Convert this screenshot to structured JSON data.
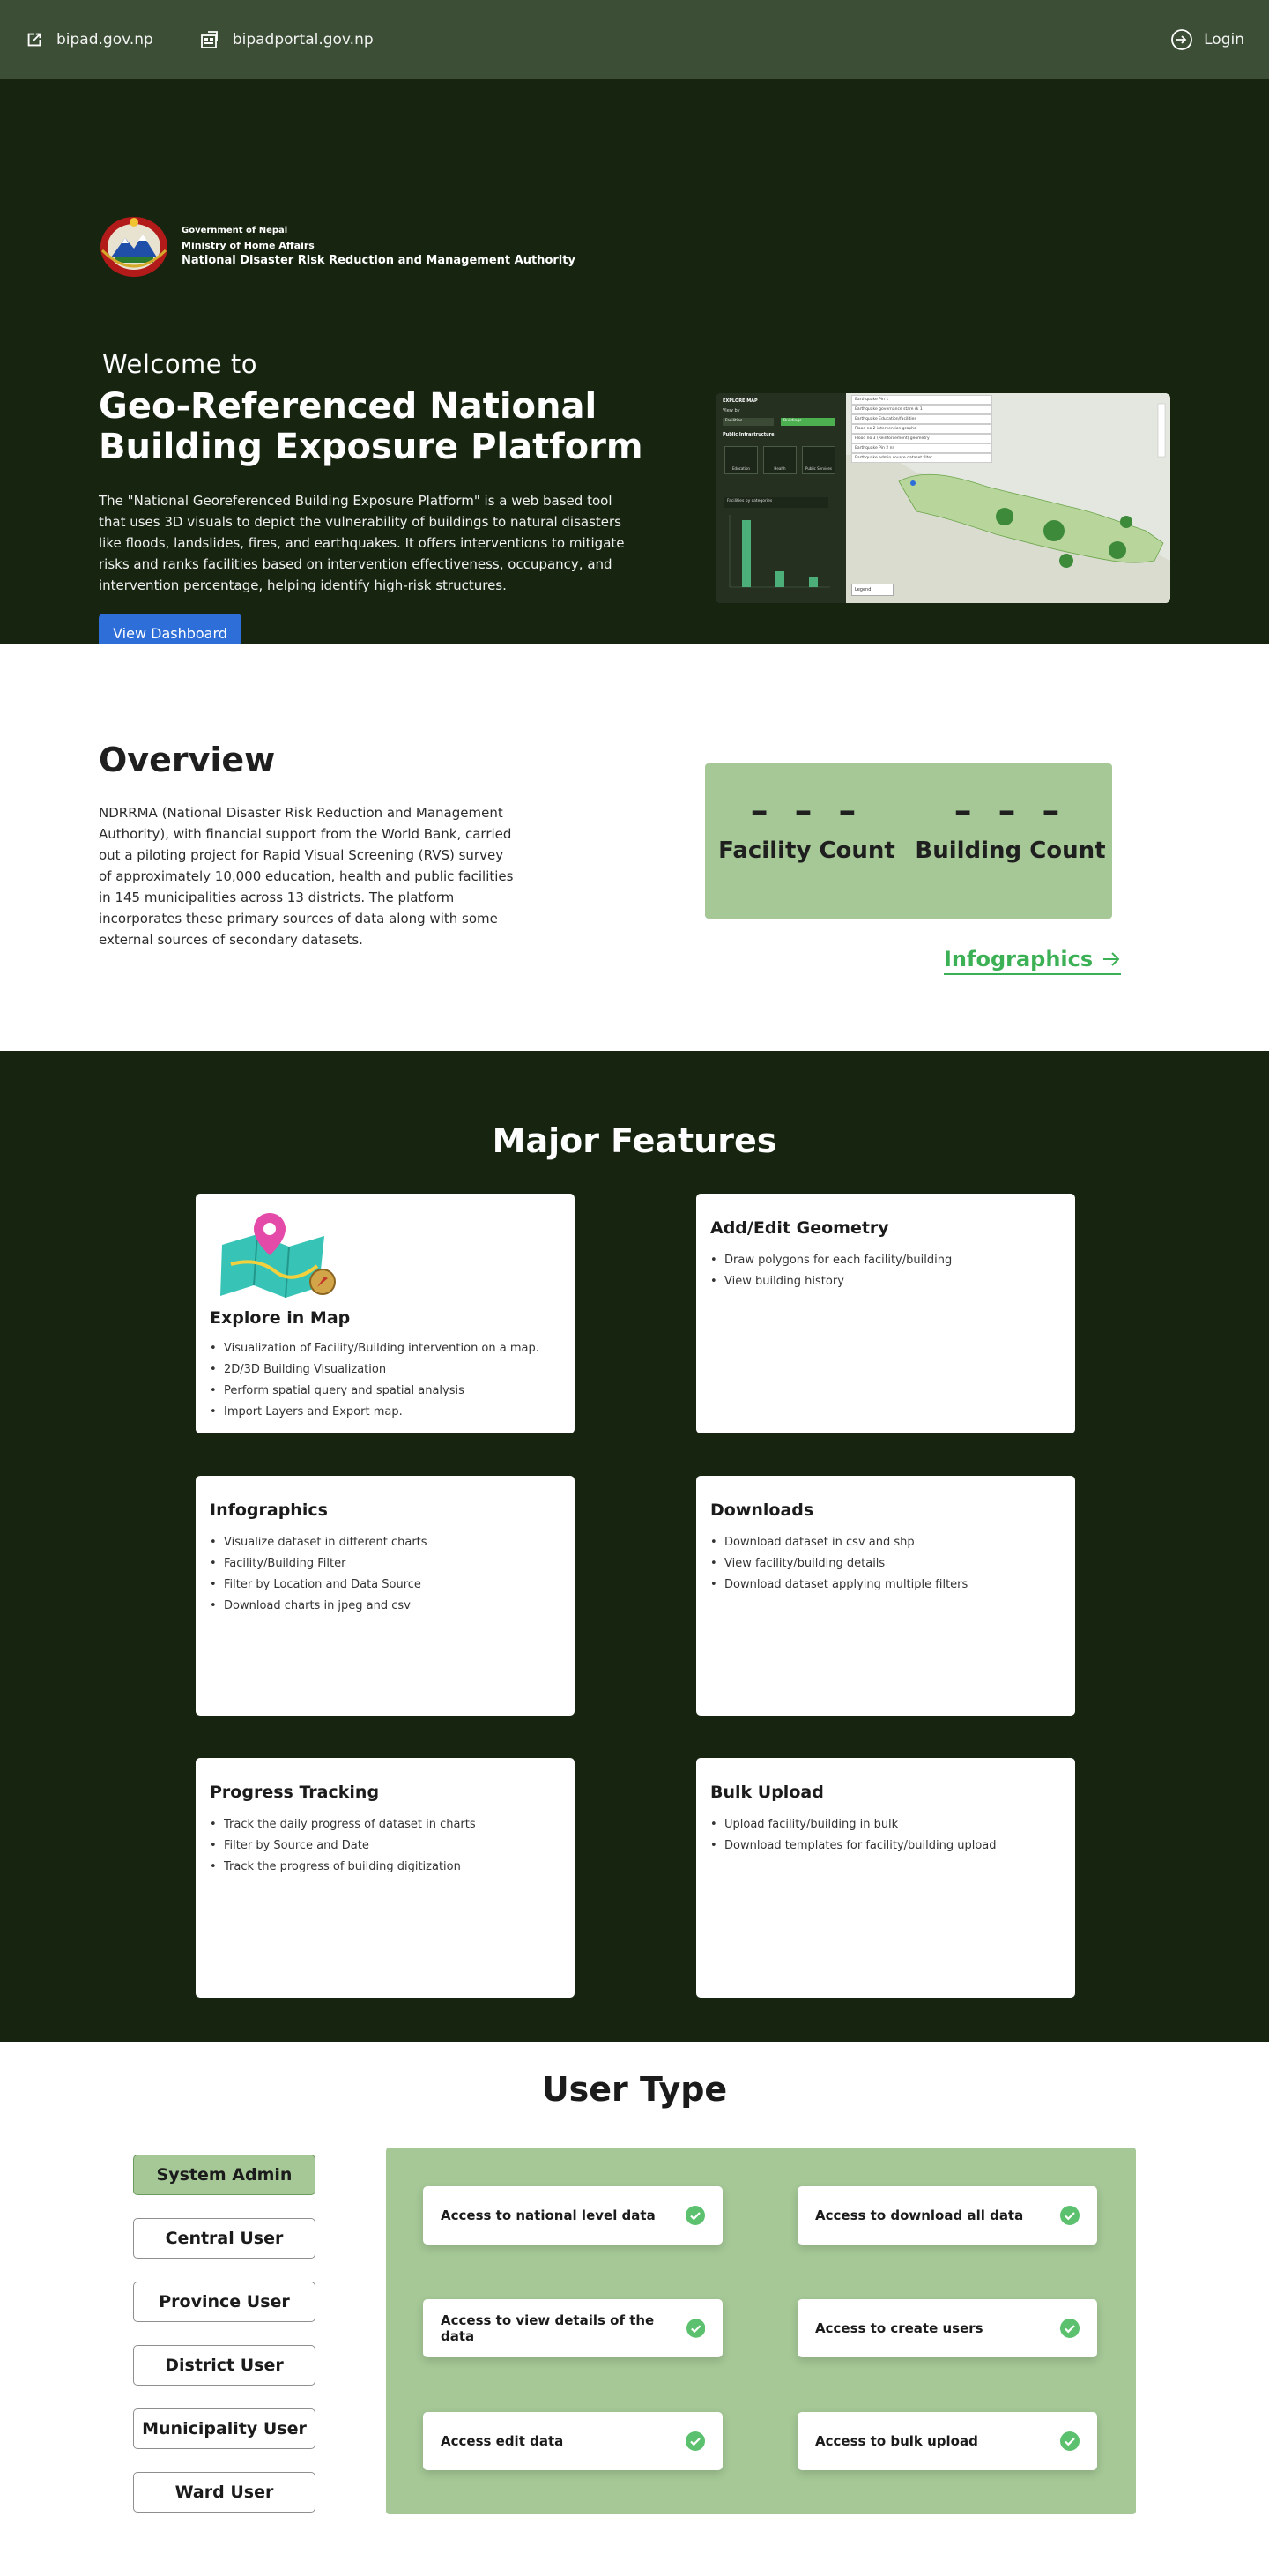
{
  "topbar": {
    "links": [
      {
        "label": "bipad.gov.np",
        "icon": "external-link-icon"
      },
      {
        "label": "bipadportal.gov.np",
        "icon": "portal-icon"
      }
    ],
    "login": {
      "label": "Login",
      "icon": "login-icon"
    },
    "bg": "#3c4f36"
  },
  "hero": {
    "org_lines": [
      "Government of Nepal",
      "Ministry of Home Affairs",
      "National Disaster Risk Reduction and Management Authority"
    ],
    "welcome": "Welcome to",
    "title": "Geo-Referenced National Building Exposure Platform",
    "description": "The \"National Georeferenced Building Exposure Platform\" is a web based tool that uses 3D visuals to depict the vulnerability of buildings to natural disasters like floods, landslides, fires, and earthquakes. It offers interventions to mitigate risks and ranks facilities based on intervention effectiveness, occupancy, and intervention percentage, helping identify high-risk structures.",
    "cta": "View Dashboard",
    "bg": "#162410",
    "cta_color": "#2e6ed8",
    "preview": {
      "header": "EXPLORE MAP",
      "view_by": "View by",
      "facilities_tab": "Facilities",
      "buildings_tab": "Buildings",
      "section": "Public Infrastructure",
      "cat1": "Education",
      "cat2": "Health",
      "cat3": "Public Services",
      "chart_label": "Facilities by categories",
      "legend": "Legend",
      "layers": [
        "Earthquake Pin 1",
        "Earthquake governance stare rk 1",
        "Earthquake Education/facilities",
        "Flood no 2 intervention graphs",
        "Flood no 3 (Reinforcement) geometry",
        "Earthquake Pin 2 nr",
        "Earthquake admin source dataset filter"
      ]
    }
  },
  "overview": {
    "title": "Overview",
    "description": "NDRRMA (National Disaster Risk Reduction and Management Authority), with financial support from the World Bank, carried out a piloting project for Rapid Visual Screening (RVS) survey of approximately 10,000 education, health and public facilities in 145 municipalities across 13 districts. The platform incorporates these primary sources of data along with some external sources of secondary datasets.",
    "stats": [
      {
        "value": "– – –",
        "label": "Facility Count"
      },
      {
        "value": "– – –",
        "label": "Building Count"
      }
    ],
    "infographics_link": "Infographics",
    "accent": "#a5c896",
    "link_color": "#3bb054"
  },
  "features": {
    "title": "Major Features",
    "cards": [
      {
        "title": "Explore in Map",
        "items": [
          "Visualization of Facility/Building intervention on a map.",
          "2D/3D Building Visualization",
          "Perform spatial query and spatial analysis",
          "Import Layers and Export map."
        ]
      },
      {
        "title": "Add/Edit Geometry",
        "items": [
          "Draw polygons for each facility/building",
          "View building history"
        ]
      },
      {
        "title": "Infographics",
        "items": [
          "Visualize dataset in different charts",
          "Facility/Building Filter",
          "Filter by Location and Data Source",
          "Download charts in jpeg and csv"
        ]
      },
      {
        "title": "Downloads",
        "items": [
          "Download dataset in csv and shp",
          "View facility/building details",
          "Download dataset applying multiple filters"
        ]
      },
      {
        "title": "Progress Tracking",
        "items": [
          "Track the daily progress of dataset in charts",
          "Filter by Source and Date",
          "Track the progress of building digitization"
        ]
      },
      {
        "title": "Bulk Upload",
        "items": [
          "Upload facility/building in bulk",
          "Download templates for facility/building upload"
        ]
      }
    ]
  },
  "usertype": {
    "title": "User Type",
    "roles": [
      "System Admin",
      "Central User",
      "Province User",
      "District User",
      "Municipality User",
      "Ward User"
    ],
    "active_role": "System Admin",
    "permissions": [
      "Access to national level data",
      "Access to download all data",
      "Access to view details of the data",
      "Access to create users",
      "Access edit data",
      "Access to bulk upload"
    ],
    "check_color": "#5cc16e"
  }
}
